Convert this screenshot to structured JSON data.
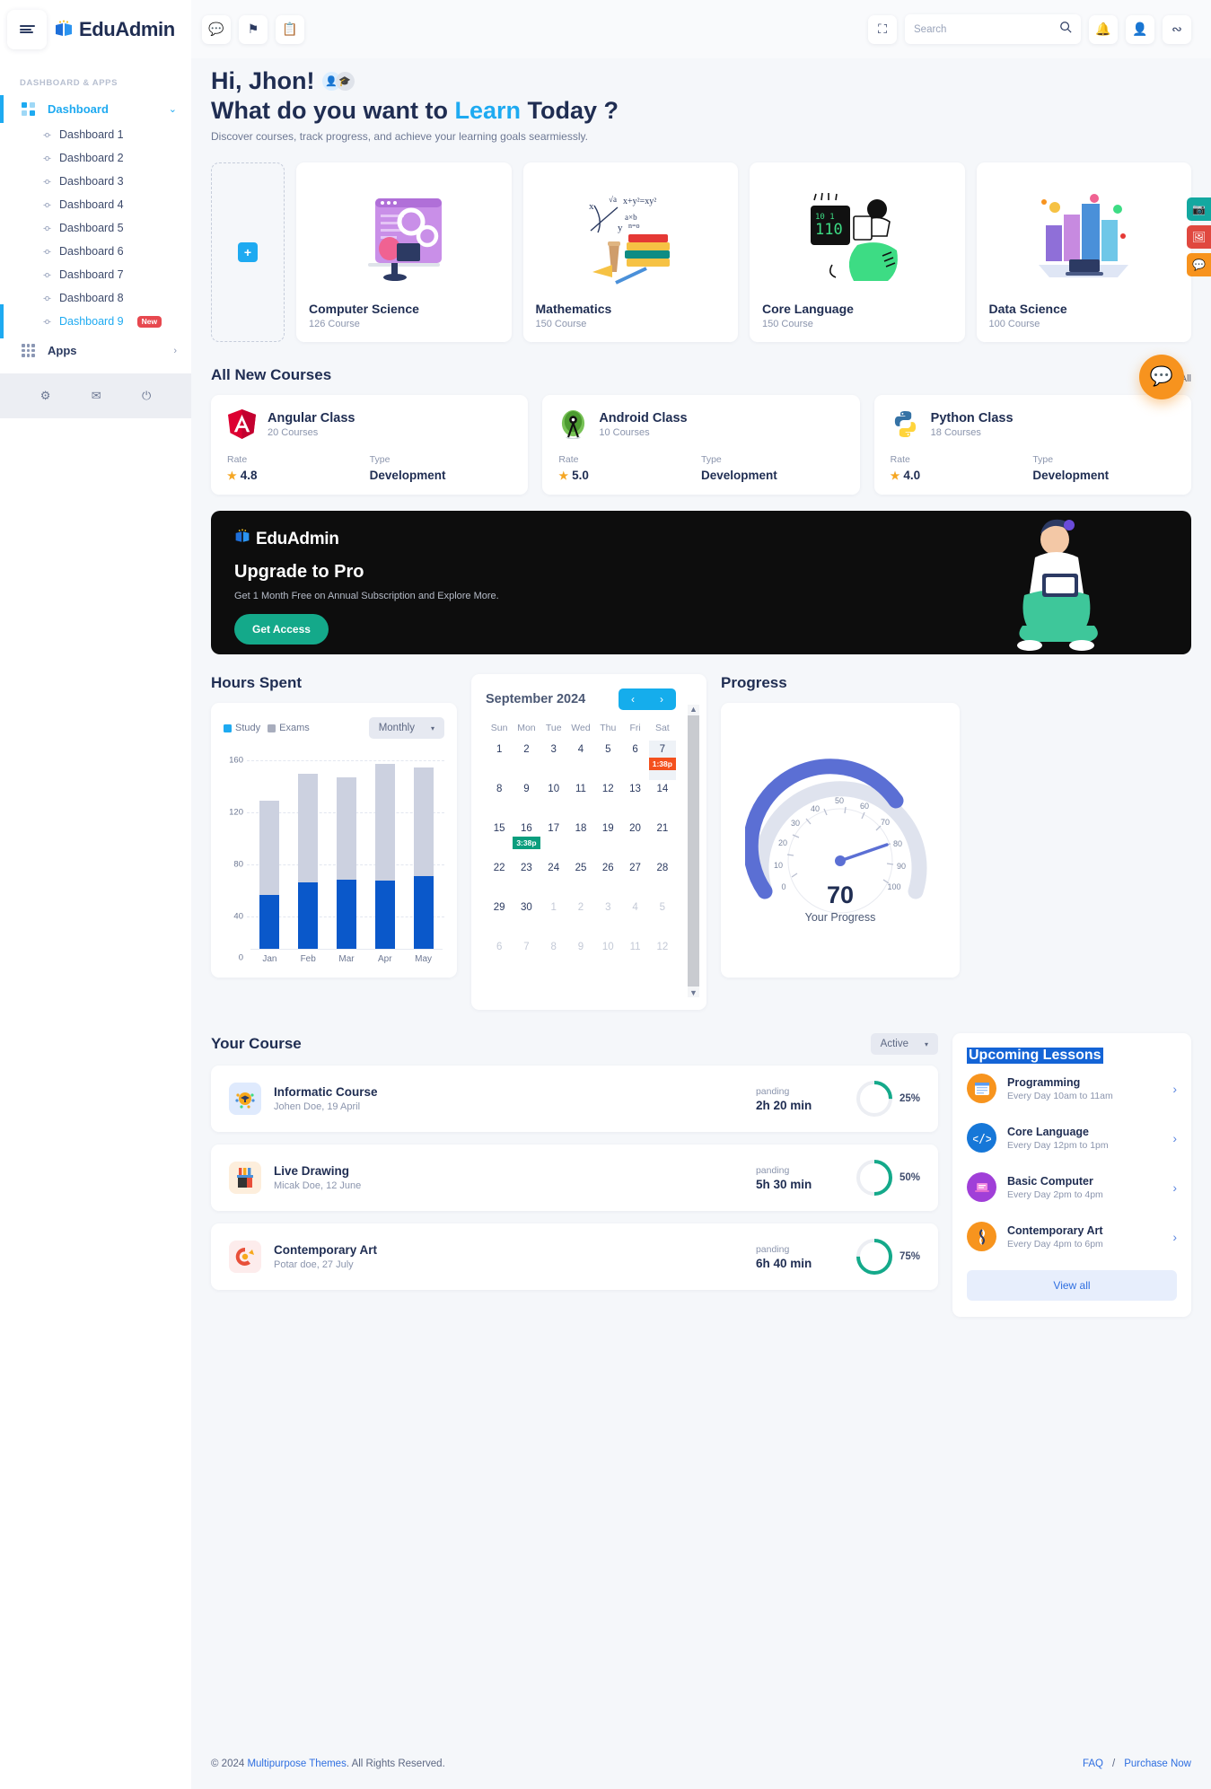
{
  "brand": {
    "name": "EduAdmin"
  },
  "sidebar": {
    "section_title": "DASHBOARD & APPS",
    "group": {
      "label": "Dashboard",
      "chevron": "⌄"
    },
    "items": [
      {
        "label": "Dashboard 1"
      },
      {
        "label": "Dashboard 2"
      },
      {
        "label": "Dashboard 3"
      },
      {
        "label": "Dashboard 4"
      },
      {
        "label": "Dashboard 5"
      },
      {
        "label": "Dashboard 6"
      },
      {
        "label": "Dashboard 7"
      },
      {
        "label": "Dashboard 8"
      },
      {
        "label": "Dashboard 9",
        "badge": "New",
        "active": true
      }
    ],
    "apps": {
      "label": "Apps",
      "arrow": "›"
    },
    "footer_icons": [
      "gear-icon",
      "mail-icon",
      "power-icon"
    ]
  },
  "topbar": {
    "left_icons": [
      "chat-icon",
      "flag-icon",
      "clipboard-icon"
    ],
    "fullscreen_icon": "fullscreen-icon",
    "search": {
      "placeholder": "Search",
      "value": ""
    },
    "right_icons": [
      "bell-icon",
      "user-icon",
      "share-icon"
    ]
  },
  "hero": {
    "greeting": "Hi, Jhon!",
    "question_pre": "What do you want to ",
    "question_hl": "Learn",
    "question_post": " Today ?",
    "subtitle": "Discover courses, track progress, and achieve your learning goals searmiessly."
  },
  "categories": {
    "add_label": "+",
    "cards": [
      {
        "name": "Computer Science",
        "count": "126 Course"
      },
      {
        "name": "Mathematics",
        "count": "150 Course"
      },
      {
        "name": "Core Language",
        "count": "150 Course"
      },
      {
        "name": "Data Science",
        "count": "100 Course"
      }
    ]
  },
  "new_courses": {
    "title": "All New Courses",
    "view_all": "View All",
    "rate_label": "Rate",
    "type_label": "Type",
    "cards": [
      {
        "name": "Angular Class",
        "courses": "20 Courses",
        "rate": "4.8",
        "type": "Development"
      },
      {
        "name": "Android Class",
        "courses": "10 Courses",
        "rate": "5.0",
        "type": "Development"
      },
      {
        "name": "Python Class",
        "courses": "18 Courses",
        "rate": "4.0",
        "type": "Development"
      }
    ]
  },
  "banner": {
    "brand": "EduAdmin",
    "title": "Upgrade to Pro",
    "subtitle": "Get 1 Month Free on Annual Subscription and Explore More.",
    "button": "Get Access"
  },
  "hours_spent": {
    "title": "Hours Spent",
    "legend": [
      "Study",
      "Exams"
    ],
    "select": "Monthly",
    "select_caret": "▾"
  },
  "chart_data": {
    "type": "bar",
    "title": "Hours Spent",
    "stacked": true,
    "categories": [
      "Jan",
      "Feb",
      "Mar",
      "Apr",
      "May"
    ],
    "series": [
      {
        "name": "Study",
        "color": "#0a58ca",
        "values": [
          44,
          54,
          56,
          55,
          59
        ]
      },
      {
        "name": "Exams",
        "color": "#ccd1e0",
        "values": [
          76,
          88,
          83,
          95,
          88
        ]
      }
    ],
    "totals": [
      120,
      142,
      139,
      150,
      147
    ],
    "ylim": [
      0,
      160
    ],
    "yticks": [
      0,
      40,
      80,
      120,
      160
    ],
    "ylabel": "",
    "xlabel": "",
    "grid": true,
    "legend_position": "top-left"
  },
  "calendar": {
    "month": "September 2024",
    "prev": "‹",
    "next": "›",
    "dow": [
      "Sun",
      "Mon",
      "Tue",
      "Wed",
      "Thu",
      "Fri",
      "Sat"
    ],
    "weeks": [
      [
        {
          "d": "1"
        },
        {
          "d": "2"
        },
        {
          "d": "3"
        },
        {
          "d": "4"
        },
        {
          "d": "5"
        },
        {
          "d": "6"
        },
        {
          "d": "7",
          "hl": true,
          "event": {
            "text": "1:38p",
            "color": "red"
          }
        }
      ],
      [
        {
          "d": "8"
        },
        {
          "d": "9"
        },
        {
          "d": "10"
        },
        {
          "d": "11"
        },
        {
          "d": "12"
        },
        {
          "d": "13"
        },
        {
          "d": "14"
        }
      ],
      [
        {
          "d": "15"
        },
        {
          "d": "16",
          "event": {
            "text": "3:38p",
            "color": "green"
          }
        },
        {
          "d": "17"
        },
        {
          "d": "18"
        },
        {
          "d": "19"
        },
        {
          "d": "20"
        },
        {
          "d": "21"
        }
      ],
      [
        {
          "d": "22"
        },
        {
          "d": "23"
        },
        {
          "d": "24"
        },
        {
          "d": "25"
        },
        {
          "d": "26"
        },
        {
          "d": "27"
        },
        {
          "d": "28"
        }
      ],
      [
        {
          "d": "29"
        },
        {
          "d": "30"
        },
        {
          "d": "1",
          "muted": true
        },
        {
          "d": "2",
          "muted": true
        },
        {
          "d": "3",
          "muted": true
        },
        {
          "d": "4",
          "muted": true
        },
        {
          "d": "5",
          "muted": true
        }
      ],
      [
        {
          "d": "6",
          "muted": true
        },
        {
          "d": "7",
          "muted": true
        },
        {
          "d": "8",
          "muted": true
        },
        {
          "d": "9",
          "muted": true
        },
        {
          "d": "10",
          "muted": true
        },
        {
          "d": "11",
          "muted": true
        },
        {
          "d": "12",
          "muted": true
        }
      ]
    ]
  },
  "progress": {
    "title": "Progress",
    "value": "70",
    "label": "Your Progress",
    "ticks": [
      "0",
      "10",
      "20",
      "30",
      "40",
      "50",
      "60",
      "70",
      "80",
      "90",
      "100"
    ],
    "color": "#5b6fd4"
  },
  "your_course": {
    "title": "Your Course",
    "filter": "Active",
    "filter_caret": "▾",
    "rows": [
      {
        "name": "Informatic Course",
        "meta": "Johen Doe, 19 April",
        "status": "panding",
        "time": "2h 20 min",
        "pct": "25%",
        "pct_num": 25,
        "icon_bg": "#dfeafd"
      },
      {
        "name": "Live Drawing",
        "meta": "Micak Doe, 12 June",
        "status": "panding",
        "time": "5h 30 min",
        "pct": "50%",
        "pct_num": 50,
        "icon_bg": "#fdeedc"
      },
      {
        "name": "Contemporary Art",
        "meta": "Potar doe, 27 July",
        "status": "panding",
        "time": "6h 40 min",
        "pct": "75%",
        "pct_num": 75,
        "icon_bg": "#fdecec"
      }
    ]
  },
  "upcoming": {
    "title": "Upcoming Lessons",
    "view_all": "View all",
    "arrow": "›",
    "items": [
      {
        "name": "Programming",
        "time": "Every Day 10am to 11am",
        "color": "#f7941e"
      },
      {
        "name": "Core Language",
        "time": "Every Day 12pm to 1pm",
        "color": "#1677d8"
      },
      {
        "name": "Basic Computer",
        "time": "Every Day 2pm to 4pm",
        "color": "#a03fd8"
      },
      {
        "name": "Contemporary Art",
        "time": "Every Day 4pm to 6pm",
        "color": "#f7941e"
      }
    ]
  },
  "footer": {
    "copyright_pre": "© 2024 ",
    "link": "Multipurpose Themes",
    "copyright_post": ". All Rights Reserved.",
    "faq": "FAQ",
    "sep": "/",
    "purchase": "Purchase Now"
  },
  "float_buttons": [
    {
      "name": "camera-icon",
      "glyph": "▣",
      "color": "#13a8a0"
    },
    {
      "name": "image-icon",
      "glyph": "⬚",
      "color": "#e0483f"
    },
    {
      "name": "message-icon",
      "glyph": "⚑",
      "color": "#f7931e"
    }
  ],
  "fab": {
    "name": "chat-fab",
    "glyph": "◔"
  }
}
